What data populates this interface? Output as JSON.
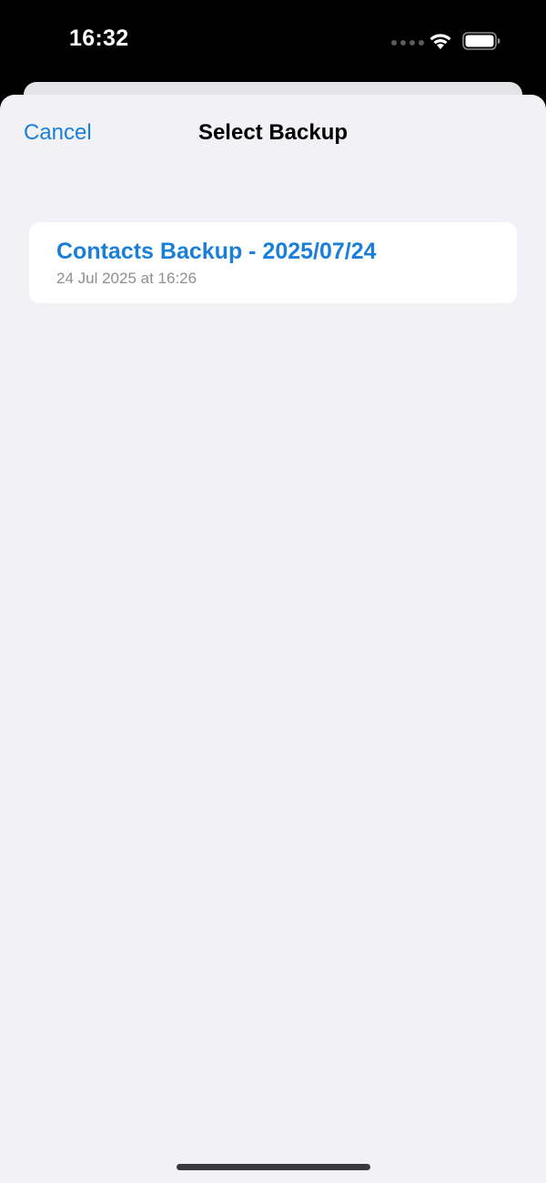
{
  "status_bar": {
    "time": "16:32",
    "icons": [
      "cellular-signal-icon",
      "wifi-icon",
      "battery-icon"
    ]
  },
  "nav": {
    "cancel_label": "Cancel",
    "title": "Select Backup"
  },
  "backups": [
    {
      "title": "Contacts Backup - 2025/07/24",
      "date": "24 Jul 2025 at 16:26"
    }
  ],
  "colors": {
    "accent": "#1a7fd9",
    "sheet_background": "#f1f1f6",
    "secondary_text": "#8e8e93"
  }
}
